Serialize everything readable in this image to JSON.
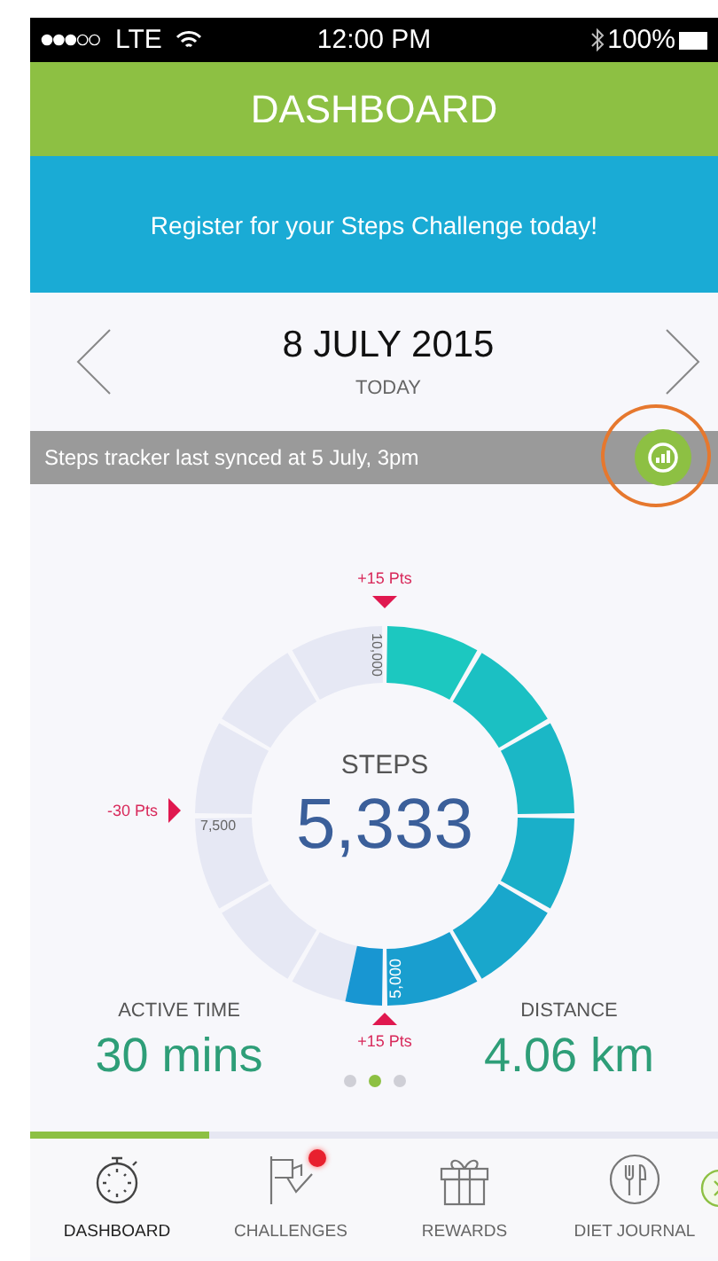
{
  "status_bar": {
    "carrier": "LTE",
    "time": "12:00 PM",
    "battery": "100%"
  },
  "header": {
    "title": "DASHBOARD"
  },
  "banner": {
    "text": "Register for your Steps Challenge today!"
  },
  "date_nav": {
    "date": "8 JULY 2015",
    "subtitle": "TODAY"
  },
  "sync_bar": {
    "text": "Steps tracker last synced at 5 July, 3pm"
  },
  "steps_gauge": {
    "title": "STEPS",
    "value": "5,333",
    "ticks": [
      {
        "label": "10,000",
        "kind": "top"
      },
      {
        "label": "7,500",
        "kind": "left"
      },
      {
        "label": "5,000",
        "kind": "bottom"
      }
    ],
    "markers": [
      {
        "label": "+15 Pts",
        "kind": "top"
      },
      {
        "label": "-30 Pts",
        "kind": "left"
      },
      {
        "label": "+15 Pts",
        "kind": "bottom"
      }
    ]
  },
  "stats": [
    {
      "label": "ACTIVE TIME",
      "value": "30 mins"
    },
    {
      "label": "DISTANCE",
      "value": "4.06 km"
    }
  ],
  "pager": [
    {
      "selected": false
    },
    {
      "selected": true
    },
    {
      "selected": false
    }
  ],
  "page_progress": {
    "level": 0.26
  },
  "tabs": [
    {
      "label": "DASHBOARD",
      "kind": "stopwatch",
      "selected": true,
      "badge": false
    },
    {
      "label": "CHALLENGES",
      "kind": "flag",
      "selected": false,
      "badge": true
    },
    {
      "label": "REWARDS",
      "kind": "gift",
      "selected": false,
      "badge": false
    },
    {
      "label": "DIET JOURNAL",
      "kind": "cutlery",
      "selected": false,
      "badge": false
    }
  ]
}
